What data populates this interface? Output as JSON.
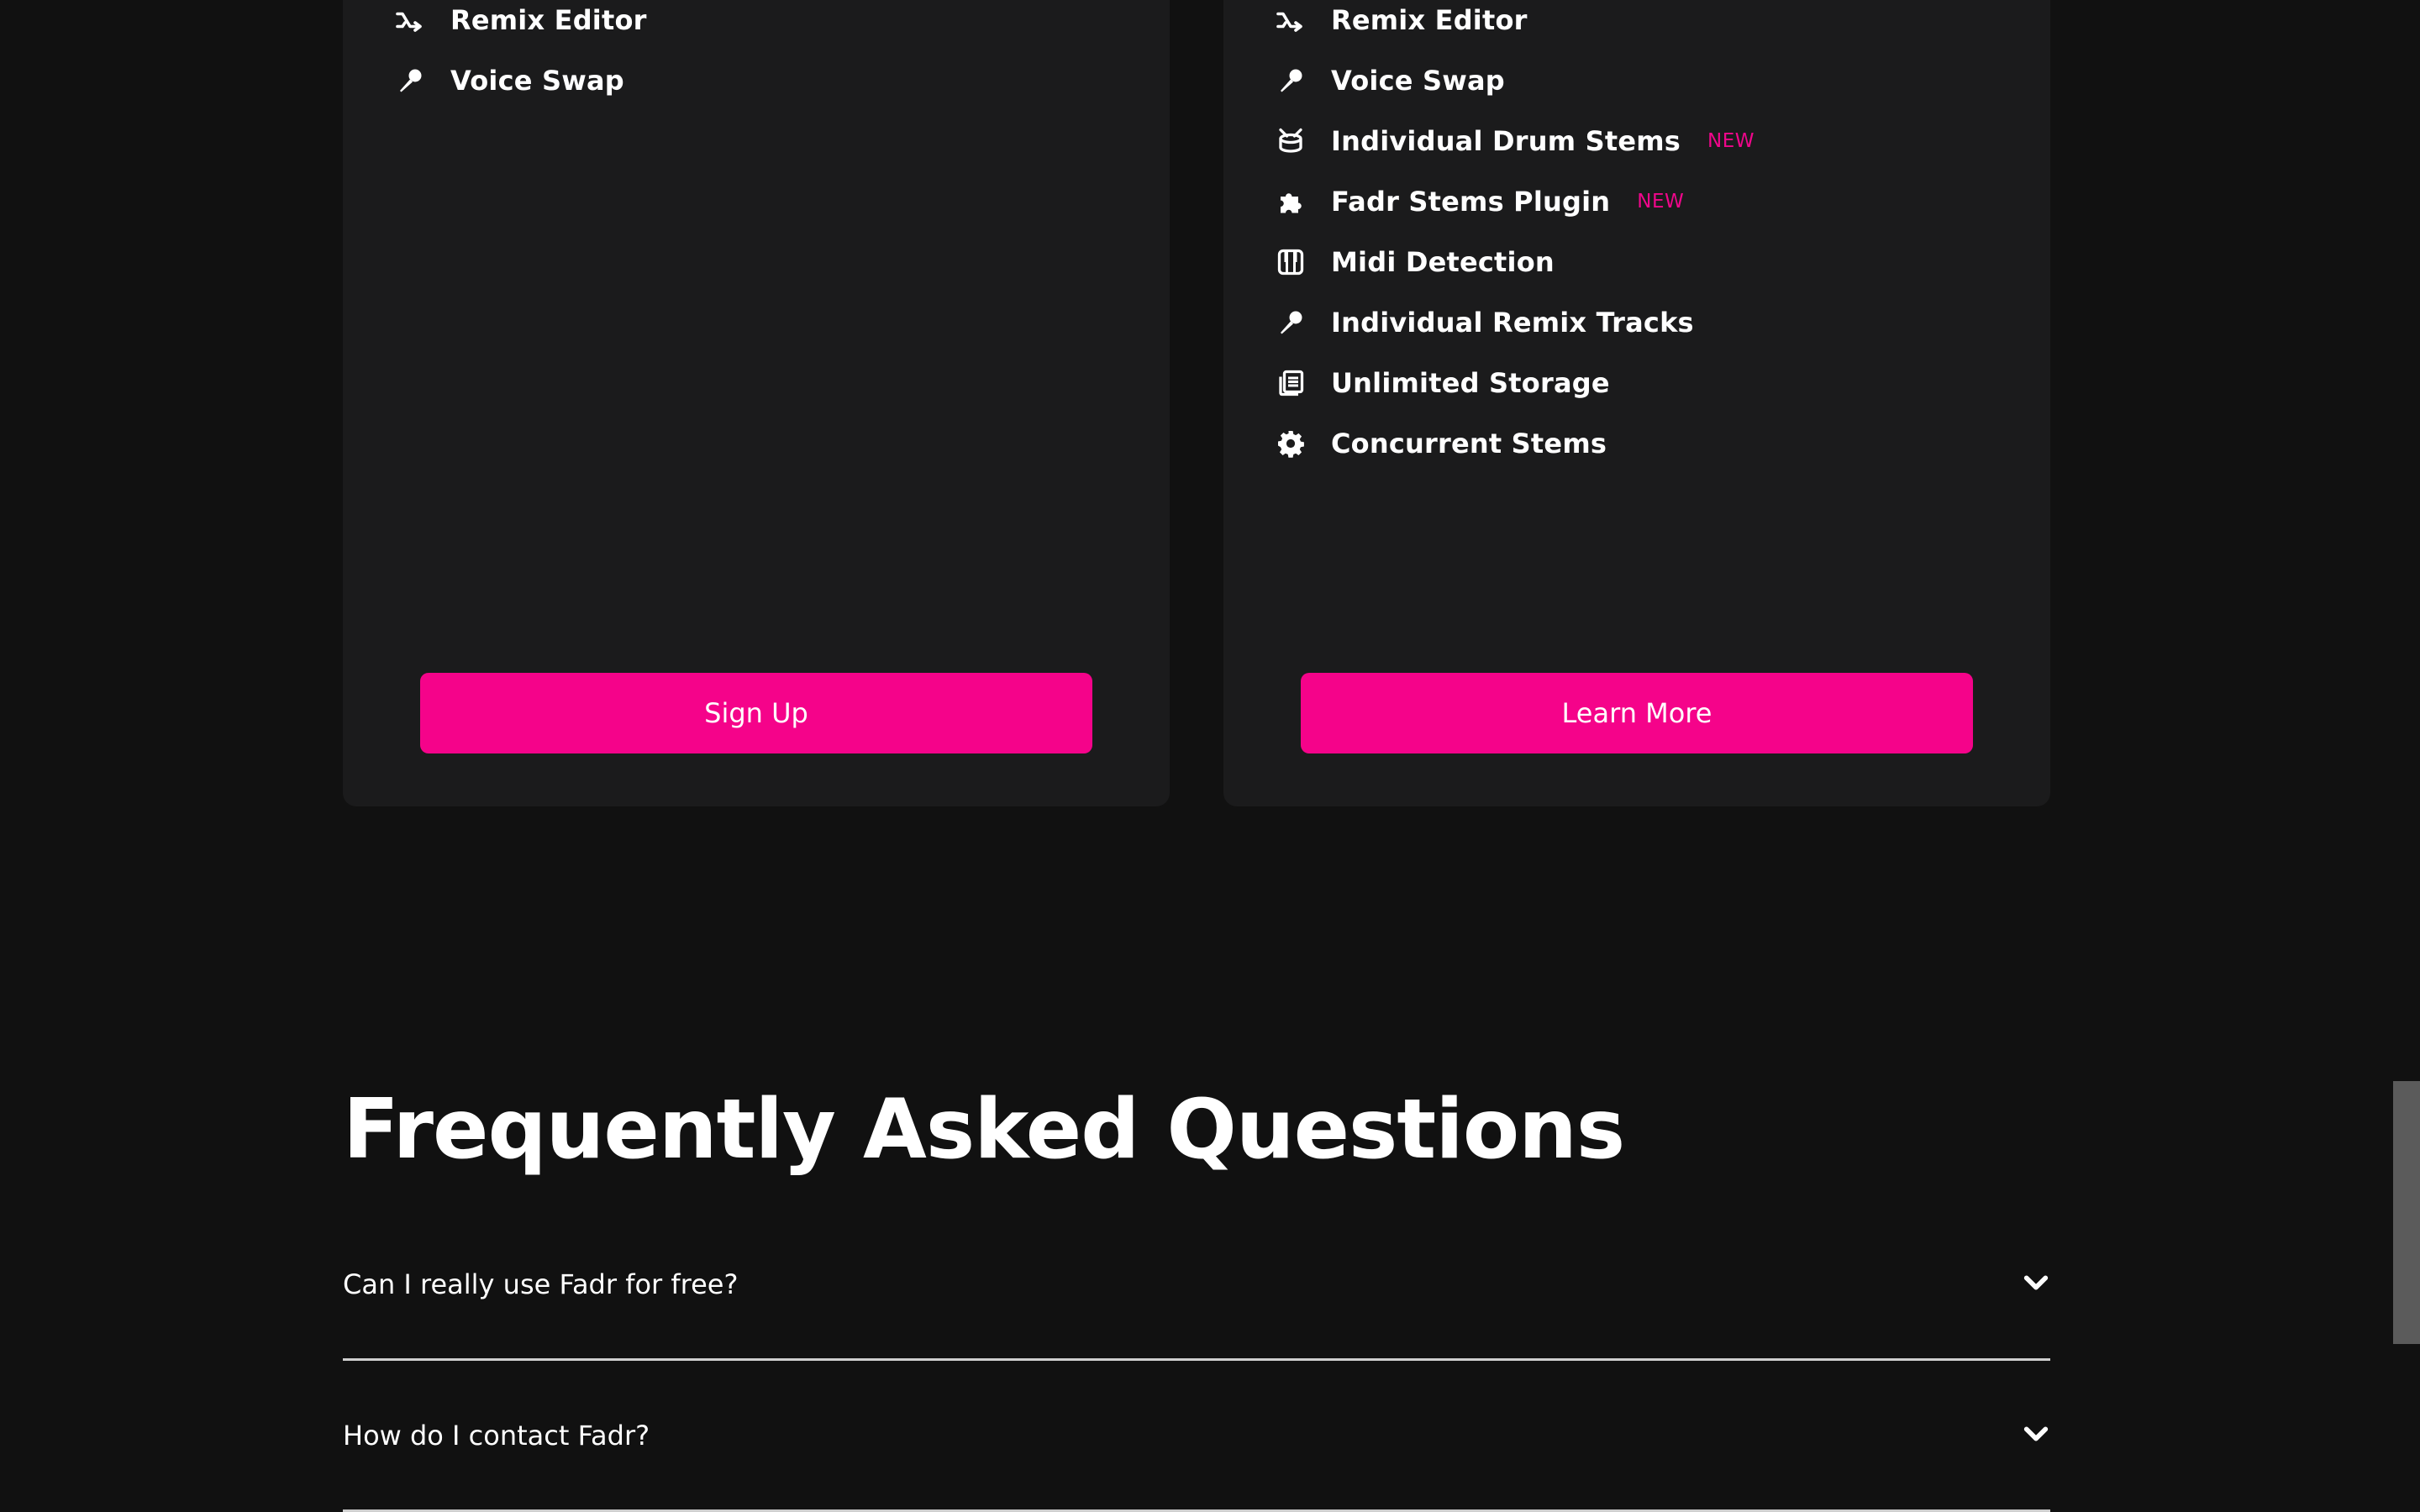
{
  "colors": {
    "background": "#111111",
    "card": "#1b1b1c",
    "accent": "#f5038a",
    "text": "#ffffff",
    "divider": "#cfcfcf"
  },
  "plans": {
    "free": {
      "features": [
        {
          "icon": "shuffle-arrow-icon",
          "label": "Remix Editor"
        },
        {
          "icon": "microphone-icon",
          "label": "Voice Swap"
        }
      ],
      "cta_label": "Sign Up"
    },
    "plus": {
      "features": [
        {
          "icon": "shuffle-arrow-icon",
          "label": "Remix Editor"
        },
        {
          "icon": "microphone-icon",
          "label": "Voice Swap"
        },
        {
          "icon": "drum-icon",
          "label": "Individual Drum Stems",
          "badge": "NEW"
        },
        {
          "icon": "puzzle-piece-icon",
          "label": "Fadr Stems Plugin",
          "badge": "NEW"
        },
        {
          "icon": "piano-keys-icon",
          "label": "Midi Detection"
        },
        {
          "icon": "microphone-icon",
          "label": "Individual Remix Tracks"
        },
        {
          "icon": "storage-icon",
          "label": "Unlimited Storage"
        },
        {
          "icon": "gear-icon",
          "label": "Concurrent Stems"
        }
      ],
      "cta_label": "Learn More"
    }
  },
  "faq": {
    "title": "Frequently Asked Questions",
    "items": [
      {
        "question": "Can I really use Fadr for free?",
        "icon": "chevron-down-icon"
      },
      {
        "question": "How do I contact Fadr?",
        "icon": "chevron-down-icon"
      }
    ]
  }
}
